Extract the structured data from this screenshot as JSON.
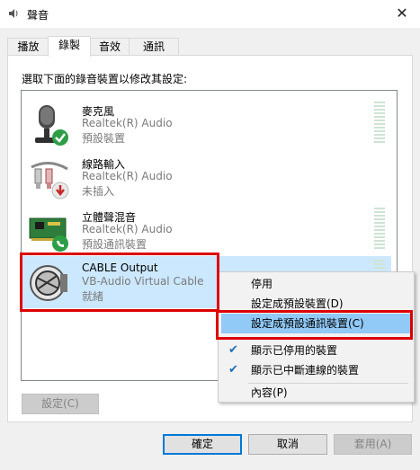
{
  "window": {
    "title": "聲音",
    "close_icon": "close-icon"
  },
  "tabs": [
    {
      "label": "播放",
      "active": false
    },
    {
      "label": "錄製",
      "active": true
    },
    {
      "label": "音效",
      "active": false
    },
    {
      "label": "通訊",
      "active": false
    }
  ],
  "instruction": "選取下面的錄音裝置以修改其設定:",
  "devices": [
    {
      "name": "麥克風",
      "driver": "Realtek(R) Audio",
      "status": "預設裝置",
      "icon": "microphone-icon",
      "badge": "default-check-badge",
      "selected": false
    },
    {
      "name": "線路輸入",
      "driver": "Realtek(R) Audio",
      "status": "未插入",
      "icon": "line-in-cable-icon",
      "badge": "unplugged-badge",
      "selected": false
    },
    {
      "name": "立體聲混音",
      "driver": "Realtek(R) Audio",
      "status": "預設通訊裝置",
      "icon": "sound-card-icon",
      "badge": "phone-badge",
      "selected": false
    },
    {
      "name": "CABLE Output",
      "driver": "VB-Audio Virtual Cable",
      "status": "就緒",
      "icon": "cable-device-icon",
      "badge": "",
      "selected": true
    }
  ],
  "context_menu": {
    "items": [
      {
        "label": "停用",
        "checked": false,
        "hover": false
      },
      {
        "label": "設定成預設裝置(D)",
        "checked": false,
        "hover": false
      },
      {
        "label": "設定成預設通訊裝置(C)",
        "checked": false,
        "hover": true
      },
      {
        "label": "顯示已停用的裝置",
        "checked": true,
        "hover": false
      },
      {
        "label": "顯示已中斷連線的裝置",
        "checked": true,
        "hover": false
      },
      {
        "label": "內容(P)",
        "checked": false,
        "hover": false
      }
    ]
  },
  "buttons": {
    "configure": "設定(C)",
    "ok": "確定",
    "cancel": "取消",
    "apply": "套用(A)"
  },
  "colors": {
    "selection": "#cce8ff",
    "menu_hover": "#91c9f7",
    "annotation": "#dd0000"
  }
}
